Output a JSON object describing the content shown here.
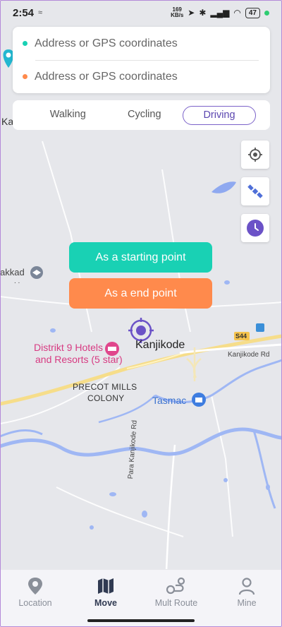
{
  "status_bar": {
    "time": "2:54",
    "speed": "169",
    "speed_unit": "KB/s",
    "battery": "47"
  },
  "address": {
    "start_placeholder": "Address or GPS coordinates",
    "end_placeholder": "Address or GPS coordinates",
    "start_dot_color": "#19d1b4",
    "end_dot_color": "#ff8a4c"
  },
  "modes": {
    "walking": "Walking",
    "cycling": "Cycling",
    "driving": "Driving",
    "selected": "Driving"
  },
  "actions": {
    "start_label": "As a starting point",
    "end_label": "As a end point"
  },
  "map": {
    "place_main": "Kanjikode",
    "hotel": "Distrikt 9 Hotels and Resorts (5 star)",
    "hotel_line1": "Distrikt 9 Hotels",
    "hotel_line2": "and Resorts (5 star)",
    "colony_line1": "PRECOT MILLS",
    "colony_line2": "COLONY",
    "tasmac": "Tasmac",
    "road_label": "Kanjikode Rd",
    "highway": "S44",
    "side_road": "Para Kanjikode Rd",
    "edge_top": "Ka",
    "edge_left": "akkad",
    "edge_dots": ". ."
  },
  "nav": {
    "location": "Location",
    "move": "Move",
    "mult_route": "Mult Route",
    "mine": "Mine",
    "active": "Move"
  }
}
